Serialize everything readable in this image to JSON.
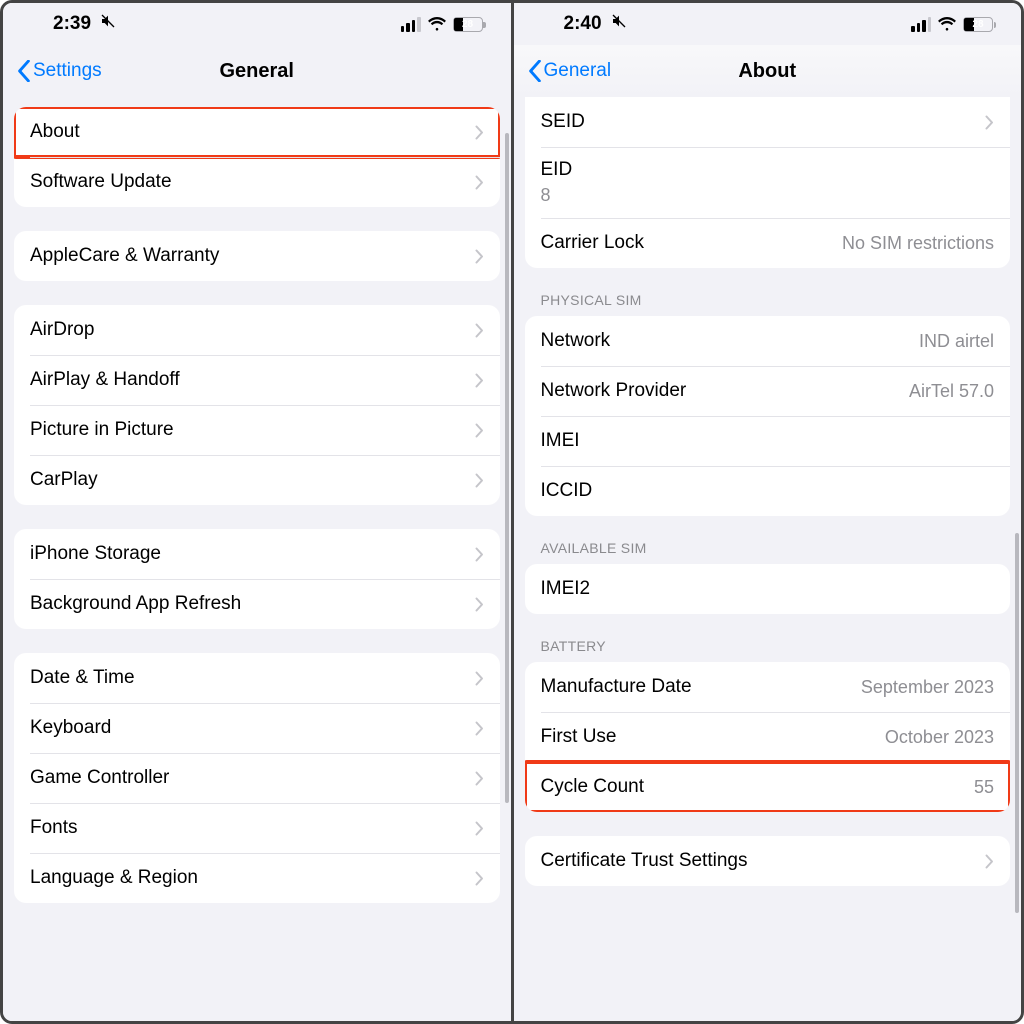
{
  "left": {
    "status": {
      "time": "2:39",
      "battery": "28"
    },
    "nav": {
      "back": "Settings",
      "title": "General"
    },
    "groups": [
      {
        "rows": [
          {
            "label": "About",
            "chevron": true,
            "highlight": true
          },
          {
            "label": "Software Update",
            "chevron": true
          }
        ]
      },
      {
        "rows": [
          {
            "label": "AppleCare & Warranty",
            "chevron": true
          }
        ]
      },
      {
        "rows": [
          {
            "label": "AirDrop",
            "chevron": true
          },
          {
            "label": "AirPlay & Handoff",
            "chevron": true
          },
          {
            "label": "Picture in Picture",
            "chevron": true
          },
          {
            "label": "CarPlay",
            "chevron": true
          }
        ]
      },
      {
        "rows": [
          {
            "label": "iPhone Storage",
            "chevron": true
          },
          {
            "label": "Background App Refresh",
            "chevron": true
          }
        ]
      },
      {
        "rows": [
          {
            "label": "Date & Time",
            "chevron": true
          },
          {
            "label": "Keyboard",
            "chevron": true
          },
          {
            "label": "Game Controller",
            "chevron": true
          },
          {
            "label": "Fonts",
            "chevron": true
          },
          {
            "label": "Language & Region",
            "chevron": true
          }
        ]
      }
    ]
  },
  "right": {
    "status": {
      "time": "2:40",
      "battery": "28"
    },
    "nav": {
      "back": "General",
      "title": "About"
    },
    "top_rows": [
      {
        "label": "SEID",
        "chevron": true
      },
      {
        "label": "EID",
        "value": "8",
        "stack": true,
        "blur": true
      },
      {
        "label": "Carrier Lock",
        "value": "No SIM restrictions"
      }
    ],
    "sections": [
      {
        "header": "PHYSICAL SIM",
        "rows": [
          {
            "label": "Network",
            "value": "IND airtel"
          },
          {
            "label": "Network Provider",
            "value": "AirTel 57.0"
          },
          {
            "label": "IMEI",
            "blur": true
          },
          {
            "label": "ICCID",
            "blur": true
          }
        ]
      },
      {
        "header": "AVAILABLE SIM",
        "rows": [
          {
            "label": "IMEI2",
            "blur": true
          }
        ]
      },
      {
        "header": "BATTERY",
        "rows": [
          {
            "label": "Manufacture Date",
            "value": "September 2023"
          },
          {
            "label": "First Use",
            "value": "October 2023"
          },
          {
            "label": "Cycle Count",
            "value": "55",
            "highlight": true
          }
        ]
      }
    ],
    "bottom_group": [
      {
        "label": "Certificate Trust Settings",
        "chevron": true
      }
    ]
  }
}
